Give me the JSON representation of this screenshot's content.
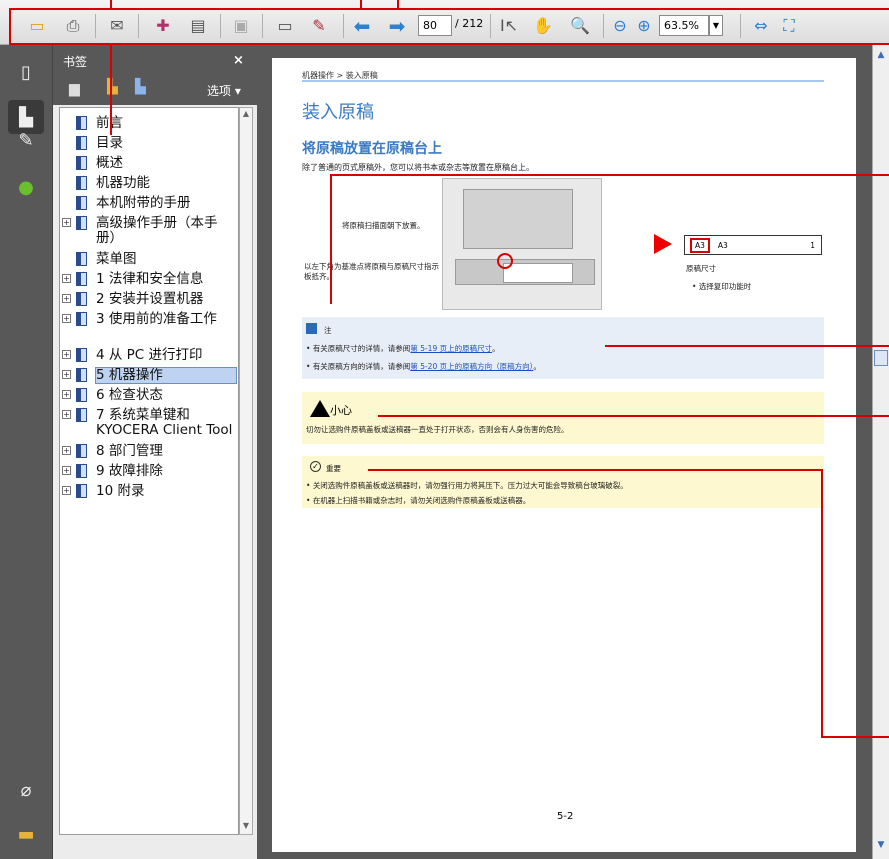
{
  "toolbar": {
    "page_current": "80",
    "page_total": "/ 212",
    "zoom": "63.5%",
    "icons": [
      "open-icon",
      "print-icon",
      "email-icon",
      "review-icon",
      "attach-icon",
      "save-icon",
      "form-icon",
      "sign-icon",
      "prev-page-icon",
      "next-page-icon",
      "select-tool-icon",
      "hand-tool-icon",
      "zoom-tool-icon",
      "zoom-out-icon",
      "zoom-in-icon",
      "fit-width-icon",
      "fit-page-icon"
    ]
  },
  "bookmarks": {
    "title": "书签",
    "close": "×",
    "options": "选项",
    "items": [
      {
        "label": "前言",
        "expandable": false,
        "selected": false
      },
      {
        "label": "目录",
        "expandable": false,
        "selected": false
      },
      {
        "label": "概述",
        "expandable": false,
        "selected": false
      },
      {
        "label": "机器功能",
        "expandable": false,
        "selected": false
      },
      {
        "label": "本机附带的手册",
        "expandable": false,
        "selected": false
      },
      {
        "label": "高级操作手册（本手册）",
        "expandable": true,
        "selected": false
      },
      {
        "label": "菜单图",
        "expandable": false,
        "selected": false
      },
      {
        "label": "1 法律和安全信息",
        "expandable": true,
        "selected": false
      },
      {
        "label": "2 安装并设置机器",
        "expandable": true,
        "selected": false
      },
      {
        "label": "3 使用前的准备工作",
        "expandable": true,
        "selected": false
      },
      {
        "label": "4 从 PC 进行打印",
        "expandable": true,
        "selected": false
      },
      {
        "label": "5 机器操作",
        "expandable": true,
        "selected": true
      },
      {
        "label": "6 检查状态",
        "expandable": true,
        "selected": false
      },
      {
        "label": "7 系统菜单键和 KYOCERA Client Tool",
        "expandable": true,
        "selected": false
      },
      {
        "label": "8 部门管理",
        "expandable": true,
        "selected": false
      },
      {
        "label": "9 故障排除",
        "expandable": true,
        "selected": false
      },
      {
        "label": "10 附录",
        "expandable": true,
        "selected": false
      }
    ]
  },
  "doc": {
    "breadcrumb": "机器操作 > 装入原稿",
    "title": "装入原稿",
    "subtitle": "将原稿放置在原稿台上",
    "intro": "除了普通的页式原稿外，您可以将书本或杂志等放置在原稿台上。",
    "fig_label_1": "将原稿扫描面朝下放置。",
    "fig_label_2": "以左下角为基准点将原稿与原稿尺寸指示板抵齐。",
    "fig_panel_a3": "A3",
    "fig_panel_right": "A3",
    "fig_panel_num": "1",
    "fig_caption": "原稿尺寸",
    "fig_bullet": "选择复印功能时",
    "note_title": "注",
    "note_line1_pre": "有关原稿尺寸的详情，请参阅",
    "note_line1_link": "第 5-19 页上的原稿尺寸",
    "note_line2_pre": "有关原稿方向的详情，请参阅",
    "note_line2_link": "第 5-20 页上的原稿方向（原稿方向）",
    "warn_title": "小心",
    "warn_text": "切勿让选购件原稿盖板或送稿器一直处于打开状态，否则会有人身伤害的危险。",
    "imp_title": "重要",
    "imp_line1": "关闭选购件原稿盖板或送稿器时，请勿强行用力将其压下。压力过大可能会导致稿台玻璃破裂。",
    "imp_line2": "在机器上扫描书籍或杂志时，请勿关闭选购件原稿盖板或送稿器。",
    "page_number": "5-2"
  }
}
